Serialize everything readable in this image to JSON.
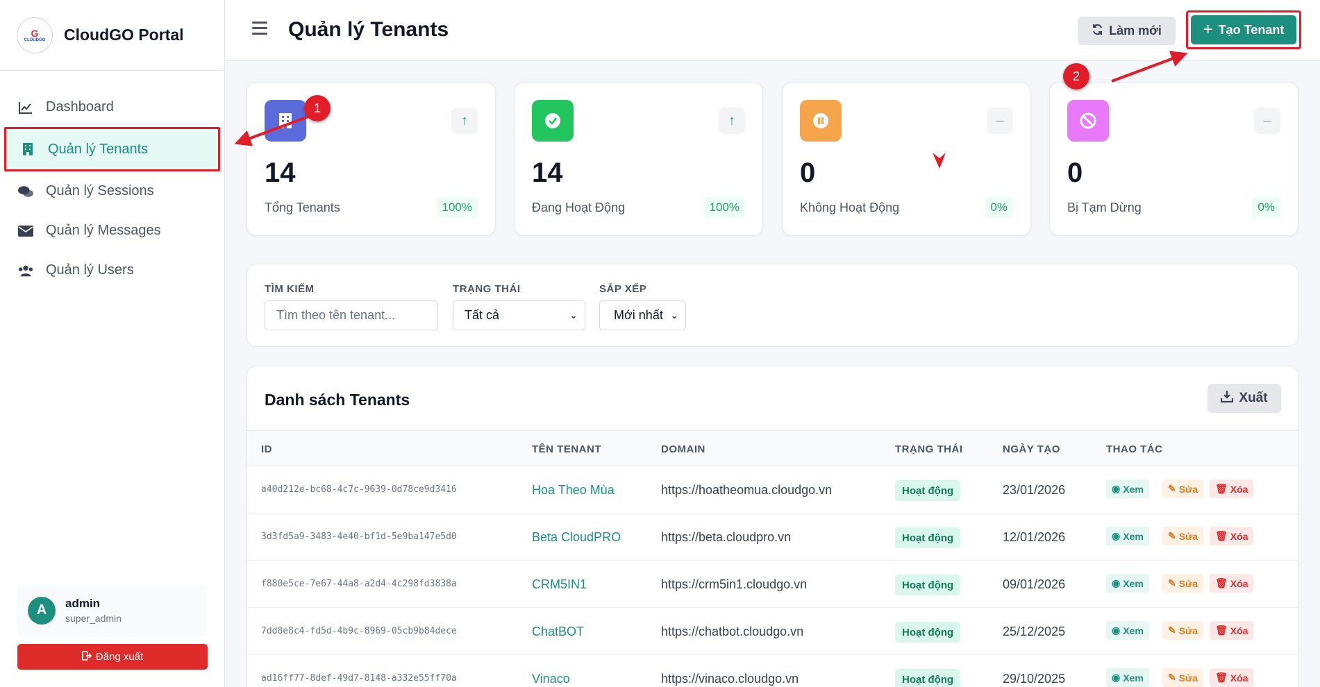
{
  "brand": {
    "logo_text": "G",
    "logo_sub": "CLOUDGO",
    "name": "CloudGO Portal"
  },
  "nav": [
    {
      "label": "Dashboard",
      "icon": "chart-line-icon"
    },
    {
      "label": "Quản lý Tenants",
      "icon": "building-icon"
    },
    {
      "label": "Quản lý Sessions",
      "icon": "comments-icon"
    },
    {
      "label": "Quản lý Messages",
      "icon": "envelope-icon"
    },
    {
      "label": "Quản lý Users",
      "icon": "users-icon"
    }
  ],
  "user": {
    "initial": "A",
    "name": "admin",
    "role": "super_admin"
  },
  "logout_label": "Đăng xuất",
  "header": {
    "title": "Quản lý Tenants",
    "refresh_label": "Làm mới",
    "create_label": "Tạo Tenant"
  },
  "stats": [
    {
      "value": "14",
      "label": "Tổng Tenants",
      "pct": "100%",
      "color": "#5b6bdb",
      "icon": "building-icon",
      "trend": "up"
    },
    {
      "value": "14",
      "label": "Đang Hoạt Động",
      "pct": "100%",
      "color": "#22c55e",
      "icon": "check-circle-icon",
      "trend": "up"
    },
    {
      "value": "0",
      "label": "Không Hoạt Động",
      "pct": "0%",
      "color": "#f5a54a",
      "icon": "pause-circle-icon",
      "trend": "neutral"
    },
    {
      "value": "0",
      "label": "Bị Tạm Dừng",
      "pct": "0%",
      "color": "#e879f9",
      "icon": "ban-icon",
      "trend": "neutral"
    }
  ],
  "filters": {
    "search_label": "TÌM KIẾM",
    "search_placeholder": "Tìm theo tên tenant...",
    "status_label": "TRẠNG THÁI",
    "status_value": "Tất cả",
    "sort_label": "SẮP XẾP",
    "sort_value": "Mới nhất"
  },
  "table": {
    "title": "Danh sách Tenants",
    "export_label": "Xuất",
    "columns": [
      "ID",
      "TÊN TENANT",
      "DOMAIN",
      "TRẠNG THÁI",
      "NGÀY TẠO",
      "THAO TÁC"
    ],
    "rows": [
      {
        "id": "a40d212e-bc68-4c7c-9639-0d78ce9d3416",
        "name": "Hoa Theo Mùa",
        "domain": "https://hoatheomua.cloudgo.vn",
        "status": "Hoạt động",
        "date": "23/01/2026"
      },
      {
        "id": "3d3fd5a9-3483-4e40-bf1d-5e9ba147e5d0",
        "name": "Beta CloudPRO",
        "domain": "https://beta.cloudpro.vn",
        "status": "Hoạt động",
        "date": "12/01/2026"
      },
      {
        "id": "f880e5ce-7e67-44a8-a2d4-4c298fd3838a",
        "name": "CRM5IN1",
        "domain": "https://crm5in1.cloudgo.vn",
        "status": "Hoạt động",
        "date": "09/01/2026"
      },
      {
        "id": "7dd8e8c4-fd5d-4b9c-8969-05cb9b84dece",
        "name": "ChatBOT",
        "domain": "https://chatbot.cloudgo.vn",
        "status": "Hoạt động",
        "date": "25/12/2025"
      },
      {
        "id": "ad16ff77-8def-49d7-8148-a332e55ff70a",
        "name": "Vinaco",
        "domain": "https://vinaco.cloudgo.vn",
        "status": "Hoạt động",
        "date": "29/10/2025"
      }
    ],
    "actions": {
      "view": "Xem",
      "edit": "Sửa",
      "delete": "Xóa"
    }
  },
  "annotations": {
    "marker1": "1",
    "marker2": "2"
  },
  "colors": {
    "accent": "#1c8f7f",
    "danger": "#e02b2b",
    "highlight": "#e11d2a"
  }
}
